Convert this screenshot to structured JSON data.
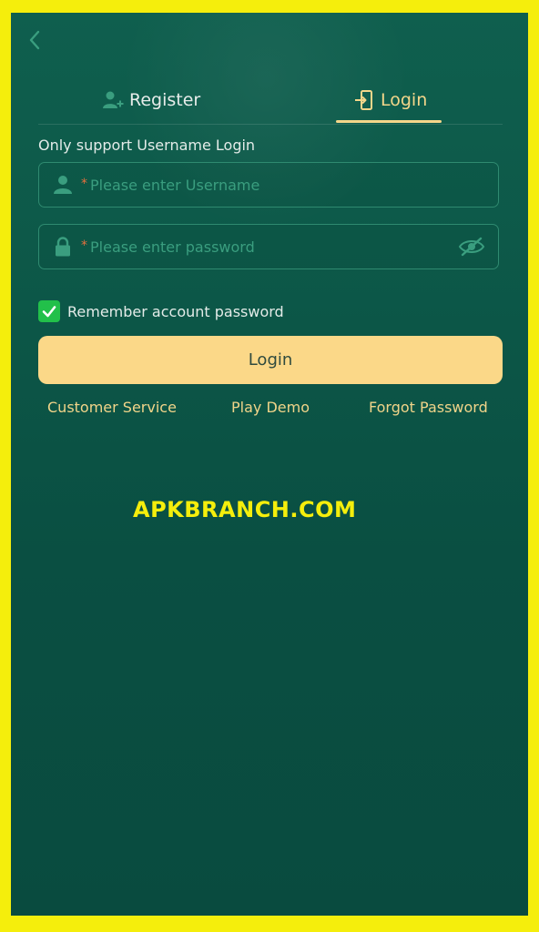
{
  "tabs": {
    "register_label": "Register",
    "login_label": "Login",
    "active": "Login"
  },
  "form": {
    "hint": "Only support Username Login",
    "required_mark": "*",
    "username_placeholder": "Please enter Username",
    "password_placeholder": "Please enter password",
    "remember_label": "Remember account password",
    "remember_checked": true,
    "submit_label": "Login"
  },
  "links": {
    "customer_service": "Customer Service",
    "play_demo": "Play Demo",
    "forgot_password": "Forgot Password"
  },
  "watermark": "APKBRANCH.COM",
  "colors": {
    "frame": "#f5ee0c",
    "background": "#0d5949",
    "accent": "#f4d68a",
    "button": "#fbd888",
    "checkbox": "#22c04a",
    "icon": "#3a9e7f"
  },
  "icons": [
    "back-chevron-icon",
    "add-user-icon",
    "login-door-icon",
    "user-icon",
    "lock-icon",
    "eye-hidden-icon",
    "check-icon"
  ]
}
